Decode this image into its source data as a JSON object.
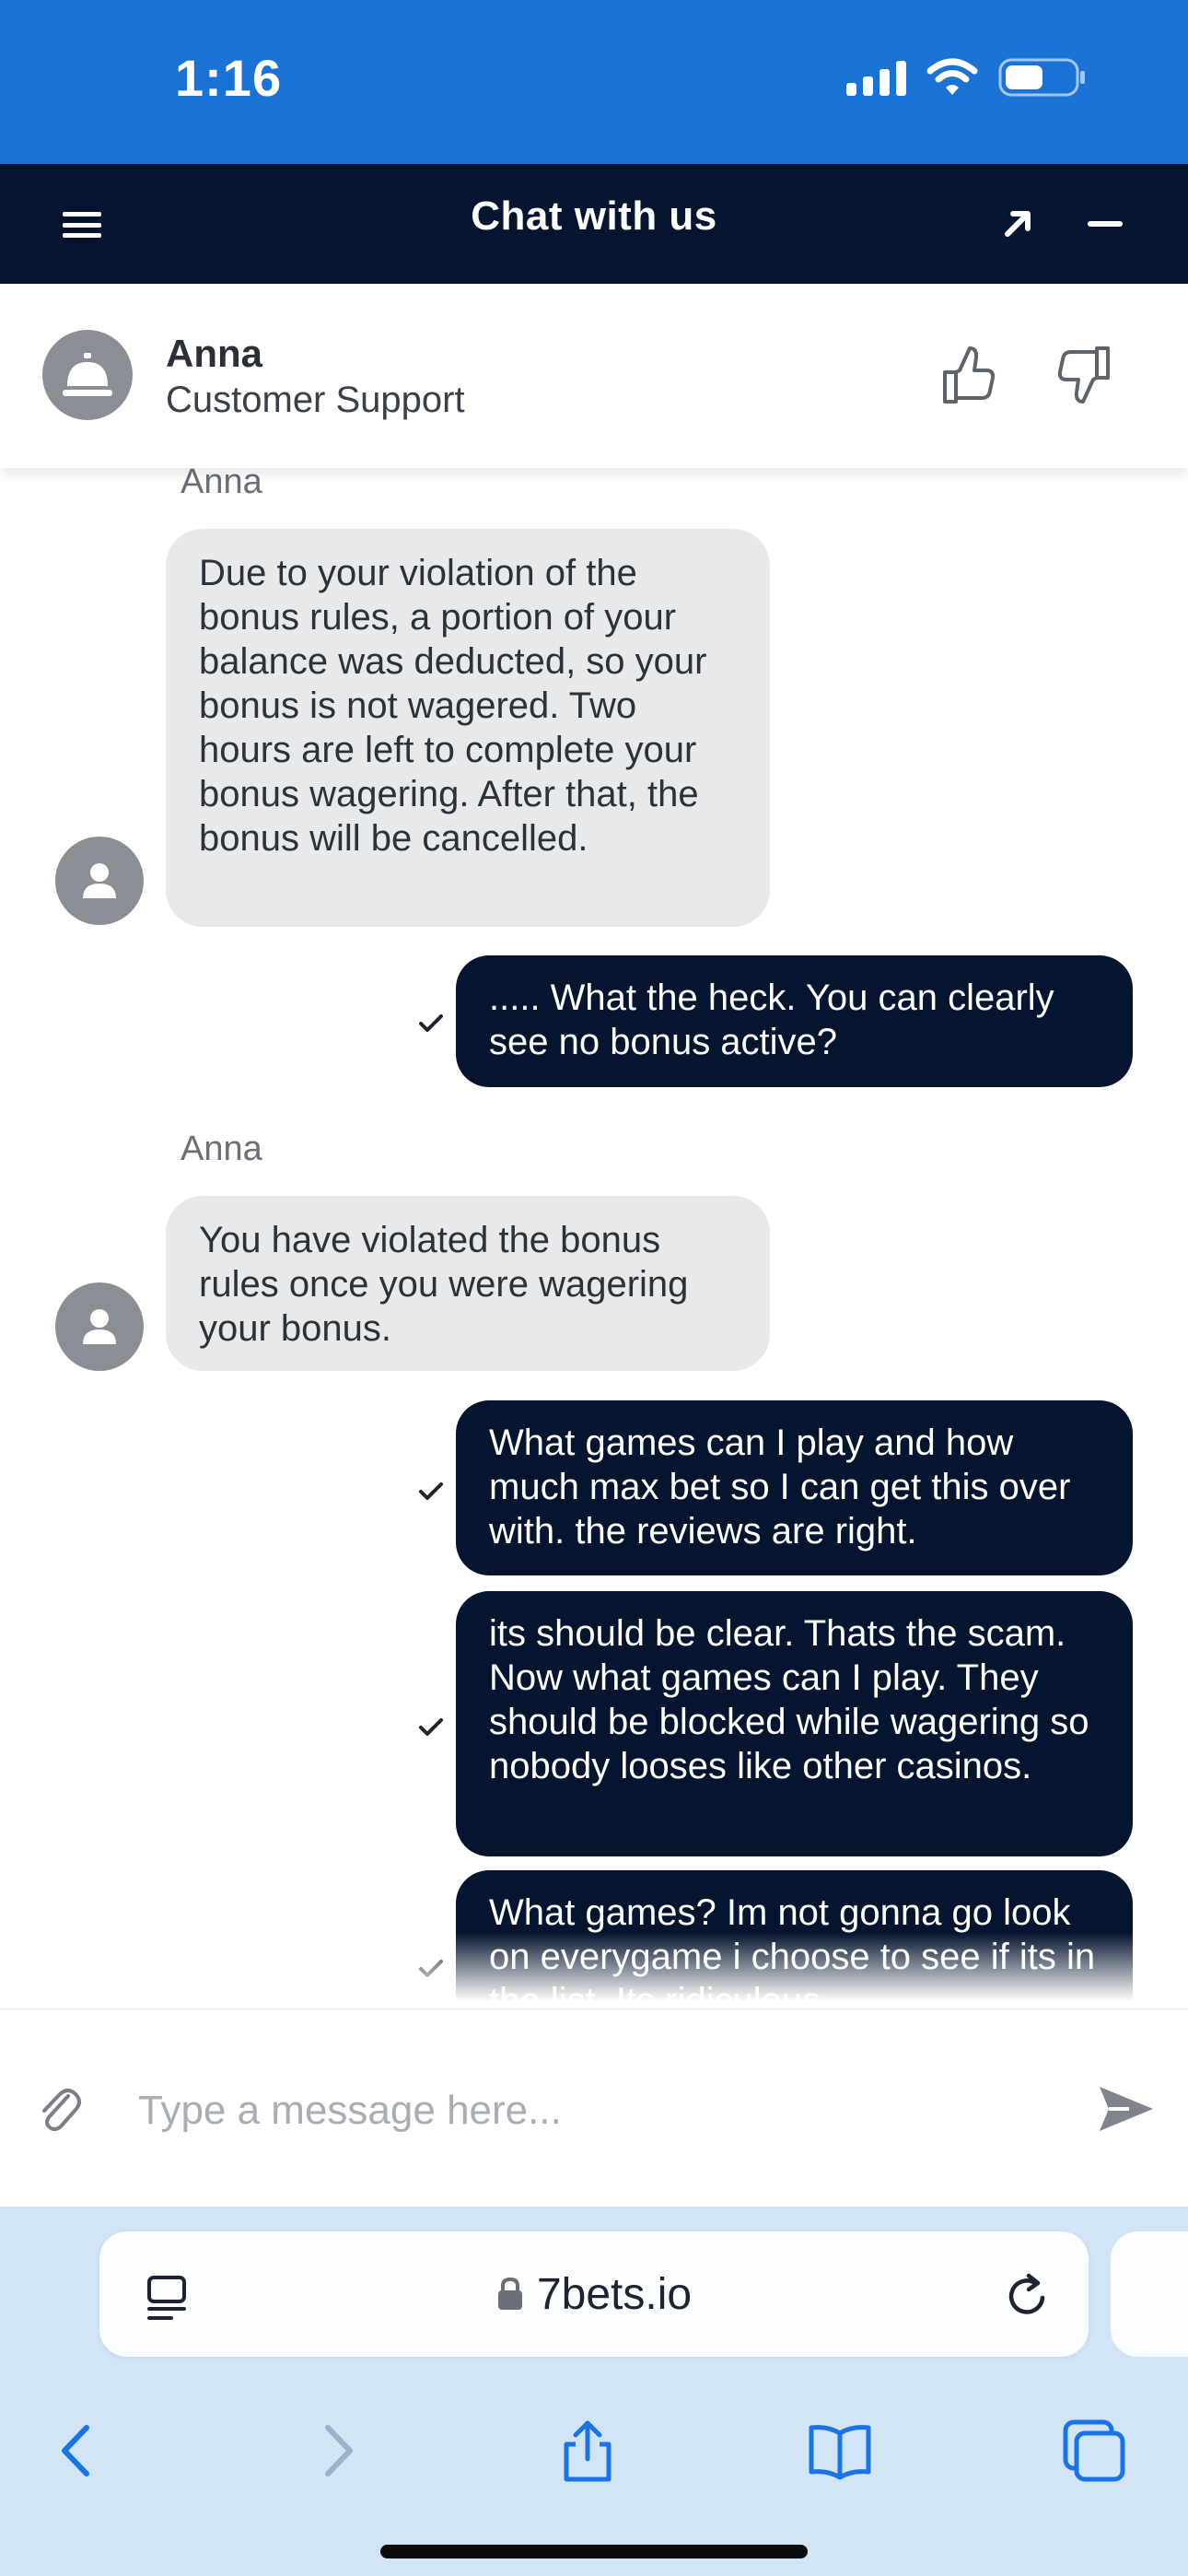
{
  "status_bar": {
    "time": "1:16"
  },
  "header": {
    "title": "Chat with us"
  },
  "agent": {
    "name": "Anna",
    "role": "Customer Support"
  },
  "messages": [
    {
      "direction": "in",
      "sender": "Anna",
      "text": "Due to your violation of the bonus rules, a portion of your balance was deducted, so your bonus is not wagered. Two hours are left to complete your bonus wagering. After that, the bonus will be cancelled."
    },
    {
      "direction": "out",
      "text": "..... What the heck. You can clearly see no bonus active?"
    },
    {
      "direction": "in",
      "sender": "Anna",
      "text": "You have violated the bonus rules once you were wagering your bonus."
    },
    {
      "direction": "out",
      "text": "What games can I play and how much max bet so I can get this over with. the reviews are right."
    },
    {
      "direction": "out",
      "text": "its should be clear. Thats the scam. Now what games can I play. They should be blocked while wagering so nobody looses like other casinos."
    },
    {
      "direction": "out",
      "text": "What games? Im not gonna go look on everygame i choose to see if its in the list. Its ridiculous"
    }
  ],
  "composer": {
    "placeholder": "Type a message here..."
  },
  "browser": {
    "url": "7bets.io"
  },
  "colors": {
    "status_bar": "#1a73d4",
    "header": "#051530",
    "incoming_bubble": "#e8e9eb",
    "outgoing_bubble": "#051530",
    "safari_bar": "#d2e5f7"
  }
}
